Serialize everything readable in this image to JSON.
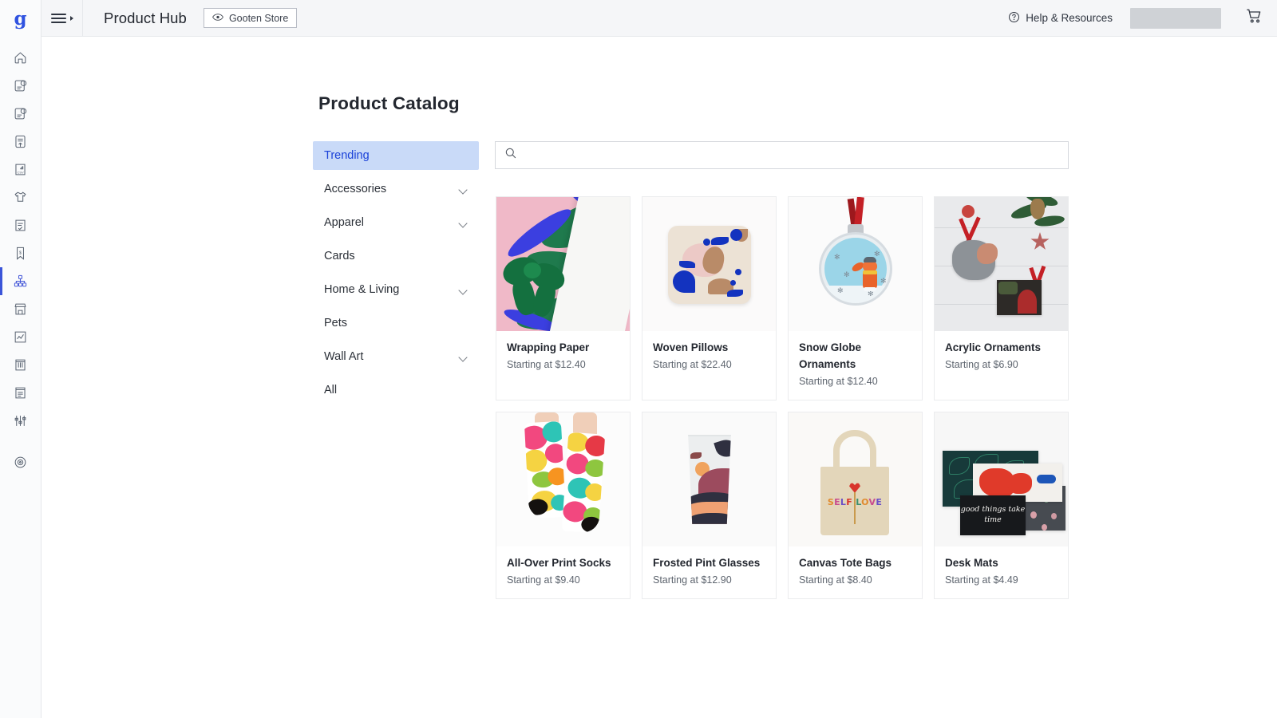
{
  "brand": {
    "logo_text": "g"
  },
  "topbar": {
    "menu_icon": "hamburger-icon",
    "page_title": "Product Hub",
    "store_chip": {
      "label": "Gooten Store",
      "icon": "eye-icon"
    },
    "help": {
      "label": "Help & Resources",
      "icon": "question-circle-icon"
    },
    "account_placeholder": "",
    "cart_icon": "shopping-cart-icon"
  },
  "rail": {
    "items": [
      {
        "name": "home-icon"
      },
      {
        "name": "new-order-icon"
      },
      {
        "name": "order-lookup-icon"
      },
      {
        "name": "upload-order-icon"
      },
      {
        "name": "csv-import-icon"
      },
      {
        "name": "apparel-icon"
      },
      {
        "name": "order-checklist-icon"
      },
      {
        "name": "price-tag-icon"
      },
      {
        "name": "product-hub-icon",
        "active": true
      },
      {
        "name": "storefront-icon"
      },
      {
        "name": "analytics-icon"
      },
      {
        "name": "billing-icon"
      },
      {
        "name": "reports-icon"
      },
      {
        "name": "settings-sliders-icon"
      },
      {
        "name": "support-target-icon"
      }
    ]
  },
  "catalog": {
    "title": "Product Catalog",
    "search": {
      "placeholder": "",
      "value": "",
      "icon": "search-icon"
    },
    "categories": [
      {
        "label": "Trending",
        "selected": true,
        "expandable": false
      },
      {
        "label": "Accessories",
        "selected": false,
        "expandable": true
      },
      {
        "label": "Apparel",
        "selected": false,
        "expandable": true
      },
      {
        "label": "Cards",
        "selected": false,
        "expandable": false
      },
      {
        "label": "Home & Living",
        "selected": false,
        "expandable": true
      },
      {
        "label": "Pets",
        "selected": false,
        "expandable": false
      },
      {
        "label": "Wall Art",
        "selected": false,
        "expandable": true
      },
      {
        "label": "All",
        "selected": false,
        "expandable": false
      }
    ],
    "products": [
      {
        "name": "Wrapping Paper",
        "price": "Starting at $12.40"
      },
      {
        "name": "Woven Pillows",
        "price": "Starting at $22.40"
      },
      {
        "name": "Snow Globe Ornaments",
        "price": "Starting at $12.40"
      },
      {
        "name": "Acrylic Ornaments",
        "price": "Starting at $6.90"
      },
      {
        "name": "All-Over Print Socks",
        "price": "Starting at $9.40"
      },
      {
        "name": "Frosted Pint Glasses",
        "price": "Starting at $12.90"
      },
      {
        "name": "Canvas Tote Bags",
        "price": "Starting at $8.40"
      },
      {
        "name": "Desk Mats",
        "price": "Starting at $4.49"
      }
    ],
    "tote_art_text": [
      "S",
      "E",
      "L",
      "F",
      "L",
      "O",
      "V",
      "E"
    ],
    "desk_mat_art_text": "good things take time"
  },
  "colors": {
    "accent": "#3b55d9",
    "selected_category_bg": "#c9daf8",
    "selected_category_text": "#1a41d8",
    "topbar_bg": "#f5f6f8",
    "skeleton": "#cfd2d6"
  }
}
